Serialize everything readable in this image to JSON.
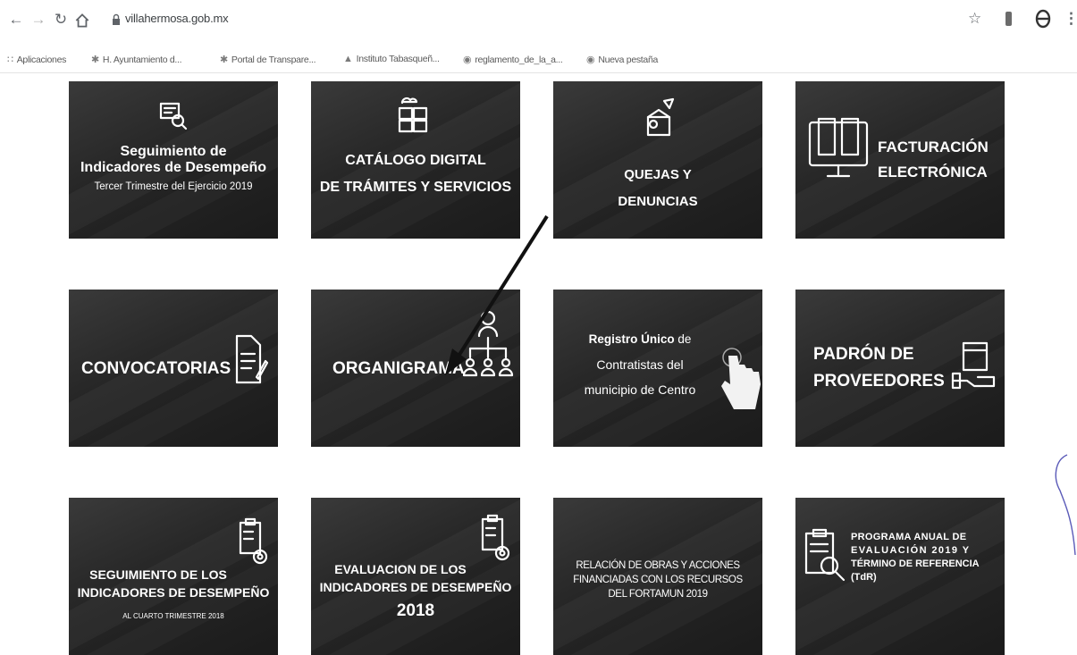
{
  "browser": {
    "url": "villahermosa.gob.mx",
    "bookmarks": [
      "Aplicaciones",
      "H. Ayuntamiento d...",
      "Portal de Transpare...",
      "Instituto Tabasqueñ...",
      "reglamento_de_la_a...",
      "Nueva pestaña"
    ],
    "icons": [
      "back-icon",
      "forward-icon",
      "reload-icon",
      "home-icon",
      "lock-icon",
      "star-icon",
      "extension-icon",
      "profile-icon",
      "menu-icon"
    ]
  },
  "tiles": {
    "seguimiento_2019": {
      "title_line1": "Seguimiento de",
      "title_line2": "Indicadores de Desempeño",
      "subtitle": "Tercer Trimestre del Ejercicio 2019"
    },
    "catalogo": {
      "line1": "CATÁLOGO DIGITAL",
      "line2": "DE TRÁMITES Y SERVICIOS"
    },
    "quejas": {
      "line1": "QUEJAS Y",
      "line2": "DENUNCIAS"
    },
    "facturacion": {
      "line1": "FACTURACIÓN",
      "line2": "ELECTRÓNICA"
    },
    "convocatorias": {
      "label": "CONVOCATORIAS"
    },
    "organigrama": {
      "label": "ORGANIGRAMA"
    },
    "registro": {
      "bold": "Registro Único",
      "rest": " de",
      "line2": "Contratistas del",
      "line3": "municipio de Centro"
    },
    "padron": {
      "line1": "PADRÓN DE",
      "line2": "PROVEEDORES"
    },
    "seguimiento_2018": {
      "line1": "SEGUIMIENTO DE LOS",
      "line2": "INDICADORES DE DESEMPEÑO",
      "subtitle": "AL CUARTO TRIMESTRE 2018"
    },
    "evaluacion": {
      "line1": "EVALUACION DE LOS",
      "line2": "INDICADORES DE DESEMPEÑO",
      "line3": "2018"
    },
    "relacion": {
      "line1": "RELACIÓN DE OBRAS Y ACCIONES",
      "line2": "FINANCIADAS CON LOS RECURSOS",
      "line3": "DEL FORTAMUN 2019"
    },
    "programa": {
      "line1": "PROGRAMA ANUAL DE",
      "line2": "EVALUACIÓN 2019 Y",
      "line3": "TÉRMINO DE REFERENCIA",
      "line4": "(TdR)"
    }
  }
}
